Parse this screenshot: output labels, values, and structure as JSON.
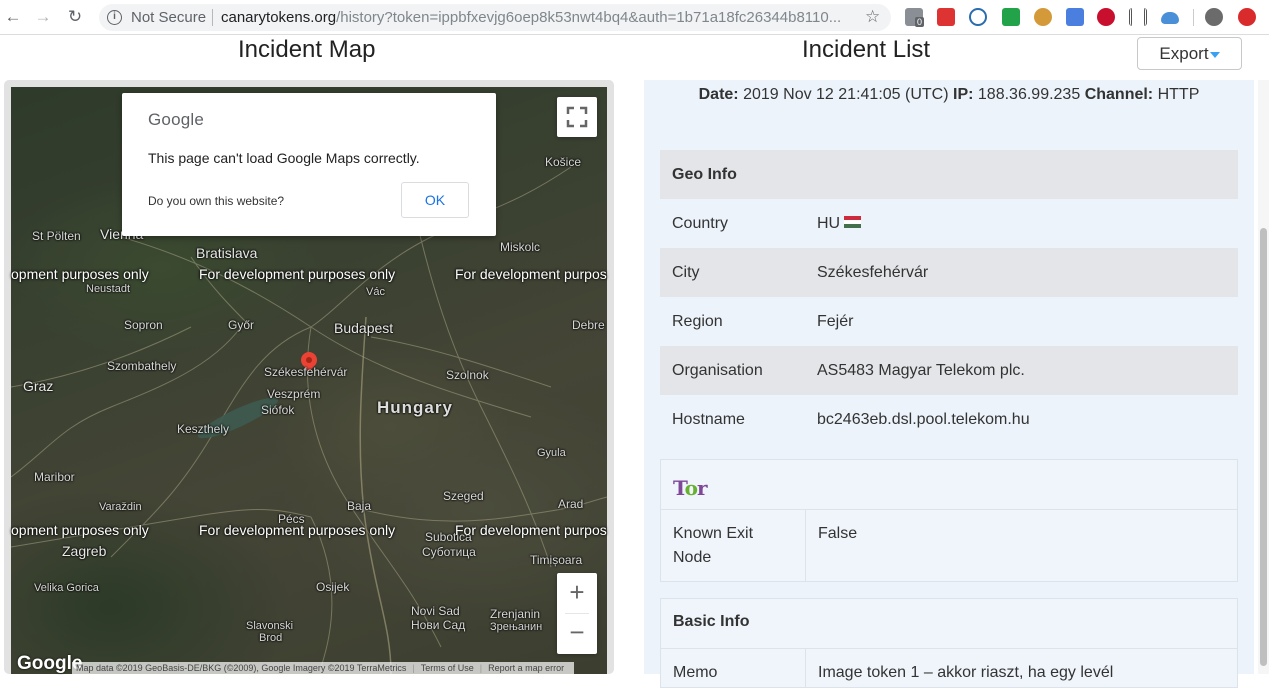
{
  "browser": {
    "security_label": "Not Secure",
    "url_host": "canarytokens.org",
    "url_path": "/history?token=ippbfxevjg6oep8k53nwt4bq4&auth=1b71a18fc26344b8110...",
    "ext_badge": "0"
  },
  "page": {
    "map_title": "Incident Map",
    "list_title": "Incident List",
    "export_label": "Export"
  },
  "map": {
    "dialog_logo": "Google",
    "dialog_message": "This page can't load Google Maps correctly.",
    "dialog_own": "Do you own this website?",
    "dialog_ok": "OK",
    "dev_text_1": "opment purposes only",
    "dev_text_2": "For development purposes only",
    "dev_text_3": "For development purpos",
    "google_logo": "Google",
    "attribution": "Map data ©2019 GeoBasis-DE/BKG (©2009), Google Imagery ©2019 TerraMetrics",
    "terms": "Terms of Use",
    "report": "Report a map error",
    "places": {
      "kosice": "Košice",
      "stpolten": "St Pölten",
      "vienna": "Vienna",
      "bratislava": "Bratislava",
      "miskolc": "Miskolc",
      "neustadt": "Neustadt",
      "vac": "Vác",
      "sopron": "Sopron",
      "gyor": "Győr",
      "budapest": "Budapest",
      "debre": "Debre",
      "szombathely": "Szombathely",
      "szekesfehervar": "Székesfehérvár",
      "szolnok": "Szolnok",
      "graz": "Graz",
      "veszprem": "Veszprém",
      "siofok": "Siófok",
      "hungary": "Hungary",
      "keszthely": "Keszthely",
      "gyula": "Gyula",
      "maribor": "Maribor",
      "baja": "Baja",
      "szeged": "Szeged",
      "arad": "Arad",
      "varazdin": "Varaždin",
      "pecs": "Pécs",
      "zagreb": "Zagreb",
      "subotica": "Subotica",
      "subotica_cyr": "Суботица",
      "timisoara": "Timișoara",
      "velika_gorica": "Velika Gorica",
      "osijek": "Osijek",
      "novi_sad": "Novi Sad",
      "novi_sad_cyr": "Нови Сад",
      "zrenjanin": "Zrenjanin",
      "zrenjanin_cyr": "Зрењанин",
      "slavonski": "Slavonski",
      "brod": "Brod"
    }
  },
  "incident": {
    "date_label": "Date:",
    "date_value": "2019 Nov 12 21:41:05 (UTC)",
    "ip_label": "IP:",
    "ip_value": "188.36.99.235",
    "channel_label": "Channel:",
    "channel_value": "HTTP"
  },
  "geo_info": {
    "title": "Geo Info",
    "rows": [
      {
        "key": "Country",
        "value": "HU"
      },
      {
        "key": "City",
        "value": "Székesfehérvár"
      },
      {
        "key": "Region",
        "value": "Fejér"
      },
      {
        "key": "Organisation",
        "value": "AS5483 Magyar Telekom plc."
      },
      {
        "key": "Hostname",
        "value": "bc2463eb.dsl.pool.telekom.hu"
      }
    ]
  },
  "tor": {
    "logo_text": "Tor",
    "known_exit_key": "Known Exit Node",
    "known_exit_value": "False"
  },
  "basic_info": {
    "title": "Basic Info",
    "memo_key": "Memo",
    "memo_value": "Image token 1 – akkor riaszt, ha egy levél"
  },
  "colors": {
    "panel_bg": "#ecf3fb",
    "alt_row": "#e3e5e8",
    "export_caret": "#3aa1f2",
    "tor_purple": "#7e4798",
    "marker_red": "#ea4335"
  }
}
